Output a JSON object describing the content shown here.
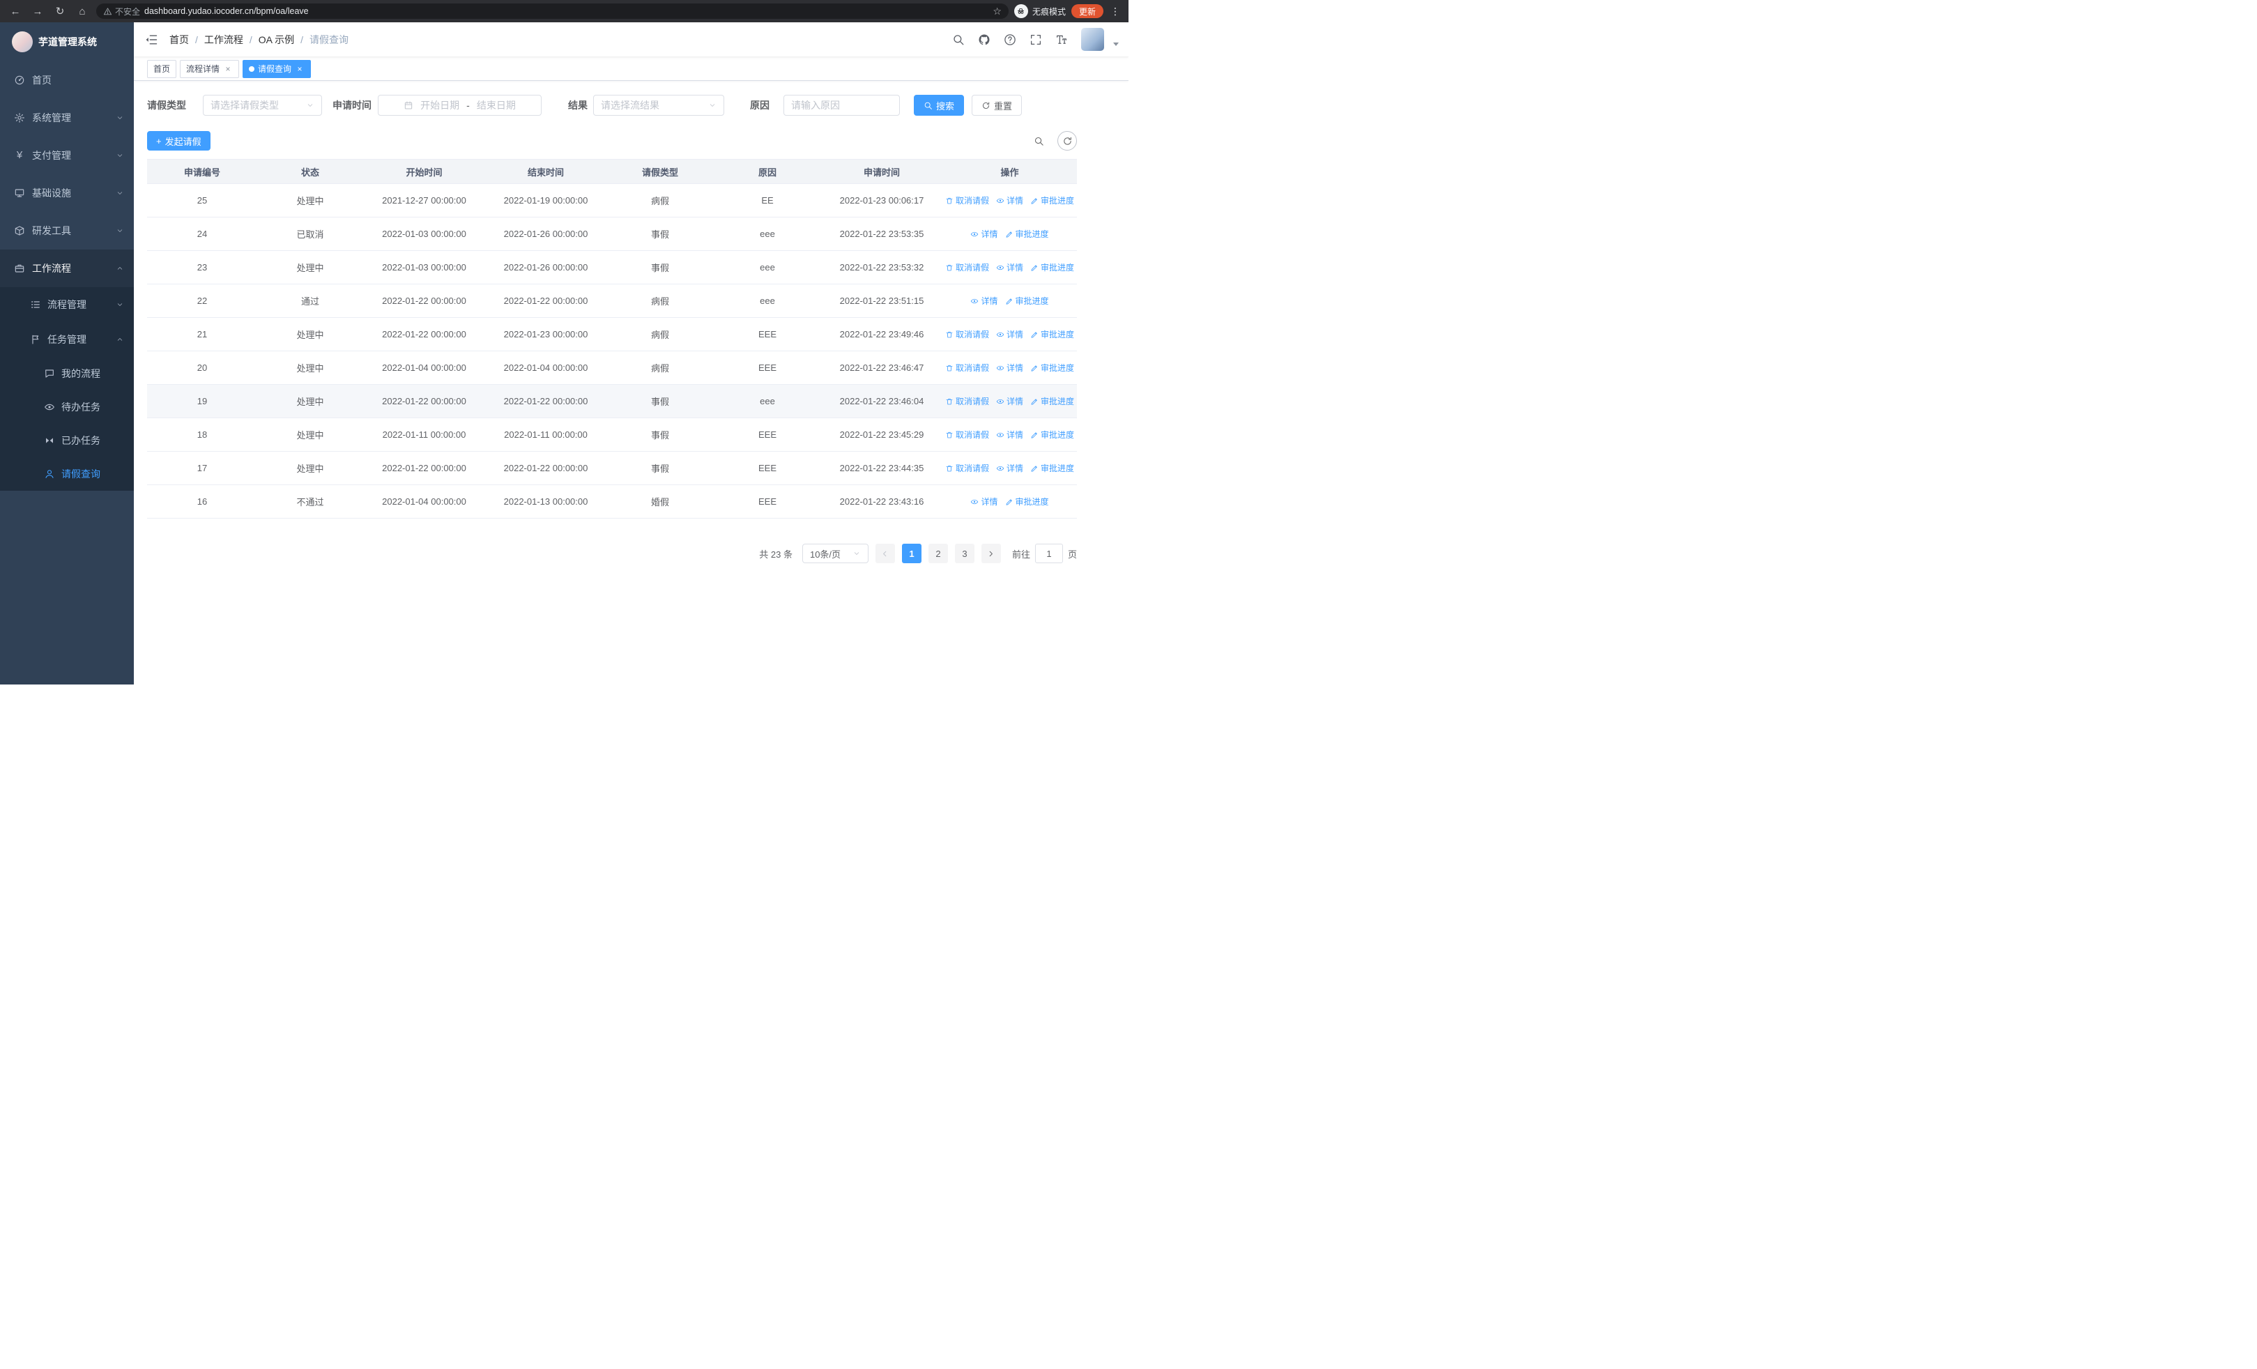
{
  "colors": {
    "accent": "#409eff",
    "sidebar_bg": "#304156",
    "sidebar_submenu_bg": "#1f2d3d",
    "sidebar_text": "#bfcbd9",
    "update_badge": "#e0532f",
    "table_header_bg": "#f2f4f7"
  },
  "browser": {
    "security_label": "不安全",
    "url": "dashboard.yudao.iocoder.cn/bpm/oa/leave",
    "incognito_label": "无痕模式",
    "update_label": "更新"
  },
  "icons": {
    "back": "←",
    "forward": "→",
    "reload": "↻",
    "home": "⌂",
    "star": "☆",
    "dots": "⋮",
    "yen": "¥"
  },
  "sidebar": {
    "title": "芋道管理系统",
    "menu": [
      {
        "label": "首页"
      },
      {
        "label": "系统管理"
      },
      {
        "label": "支付管理"
      },
      {
        "label": "基础设施"
      },
      {
        "label": "研发工具"
      },
      {
        "label": "工作流程"
      }
    ],
    "workflow_children": [
      {
        "label": "流程管理"
      },
      {
        "label": "任务管理"
      }
    ],
    "task_children": [
      {
        "label": "我的流程"
      },
      {
        "label": "待办任务"
      },
      {
        "label": "已办任务"
      },
      {
        "label": "请假查询"
      }
    ]
  },
  "navbar": {
    "breadcrumb": [
      "首页",
      "工作流程",
      "OA 示例",
      "请假查询"
    ]
  },
  "tags": [
    {
      "label": "首页",
      "closable": false,
      "active": false
    },
    {
      "label": "流程详情",
      "closable": true,
      "active": false
    },
    {
      "label": "请假查询",
      "closable": true,
      "active": true
    }
  ],
  "filters": {
    "leave_type_label": "请假类型",
    "leave_type_placeholder": "请选择请假类型",
    "apply_time_label": "申请时间",
    "start_placeholder": "开始日期",
    "range_separator": "-",
    "end_placeholder": "结束日期",
    "result_label": "结果",
    "result_placeholder": "请选择流结果",
    "reason_label": "原因",
    "reason_placeholder": "请输入原因",
    "search_label": "搜索",
    "reset_label": "重置"
  },
  "toolbar": {
    "create_label": "发起请假"
  },
  "table": {
    "columns": [
      "申请编号",
      "状态",
      "开始时间",
      "结束时间",
      "请假类型",
      "原因",
      "申请时间",
      "操作"
    ],
    "action_labels": {
      "cancel": "取消请假",
      "detail": "详情",
      "progress": "审批进度"
    },
    "rows": [
      {
        "id": "25",
        "status": "处理中",
        "start": "2021-12-27 00:00:00",
        "end": "2022-01-19 00:00:00",
        "type": "病假",
        "reason": "EE",
        "applied": "2022-01-23 00:06:17",
        "actions": [
          "cancel",
          "detail",
          "progress"
        ]
      },
      {
        "id": "24",
        "status": "已取消",
        "start": "2022-01-03 00:00:00",
        "end": "2022-01-26 00:00:00",
        "type": "事假",
        "reason": "eee",
        "applied": "2022-01-22 23:53:35",
        "actions": [
          "detail",
          "progress"
        ]
      },
      {
        "id": "23",
        "status": "处理中",
        "start": "2022-01-03 00:00:00",
        "end": "2022-01-26 00:00:00",
        "type": "事假",
        "reason": "eee",
        "applied": "2022-01-22 23:53:32",
        "actions": [
          "cancel",
          "detail",
          "progress"
        ]
      },
      {
        "id": "22",
        "status": "通过",
        "start": "2022-01-22 00:00:00",
        "end": "2022-01-22 00:00:00",
        "type": "病假",
        "reason": "eee",
        "applied": "2022-01-22 23:51:15",
        "actions": [
          "detail",
          "progress"
        ]
      },
      {
        "id": "21",
        "status": "处理中",
        "start": "2022-01-22 00:00:00",
        "end": "2022-01-23 00:00:00",
        "type": "病假",
        "reason": "EEE",
        "applied": "2022-01-22 23:49:46",
        "actions": [
          "cancel",
          "detail",
          "progress"
        ]
      },
      {
        "id": "20",
        "status": "处理中",
        "start": "2022-01-04 00:00:00",
        "end": "2022-01-04 00:00:00",
        "type": "病假",
        "reason": "EEE",
        "applied": "2022-01-22 23:46:47",
        "actions": [
          "cancel",
          "detail",
          "progress"
        ]
      },
      {
        "id": "19",
        "status": "处理中",
        "start": "2022-01-22 00:00:00",
        "end": "2022-01-22 00:00:00",
        "type": "事假",
        "reason": "eee",
        "applied": "2022-01-22 23:46:04",
        "actions": [
          "cancel",
          "detail",
          "progress"
        ],
        "hovered": true
      },
      {
        "id": "18",
        "status": "处理中",
        "start": "2022-01-11 00:00:00",
        "end": "2022-01-11 00:00:00",
        "type": "事假",
        "reason": "EEE",
        "applied": "2022-01-22 23:45:29",
        "actions": [
          "cancel",
          "detail",
          "progress"
        ]
      },
      {
        "id": "17",
        "status": "处理中",
        "start": "2022-01-22 00:00:00",
        "end": "2022-01-22 00:00:00",
        "type": "事假",
        "reason": "EEE",
        "applied": "2022-01-22 23:44:35",
        "actions": [
          "cancel",
          "detail",
          "progress"
        ]
      },
      {
        "id": "16",
        "status": "不通过",
        "start": "2022-01-04 00:00:00",
        "end": "2022-01-13 00:00:00",
        "type": "婚假",
        "reason": "EEE",
        "applied": "2022-01-22 23:43:16",
        "actions": [
          "detail",
          "progress"
        ]
      }
    ]
  },
  "pagination": {
    "total": "共 23 条",
    "page_size": "10条/页",
    "pages": [
      "1",
      "2",
      "3"
    ],
    "active_page": "1",
    "goto_label": "前往",
    "goto_value": "1",
    "goto_suffix": "页"
  }
}
